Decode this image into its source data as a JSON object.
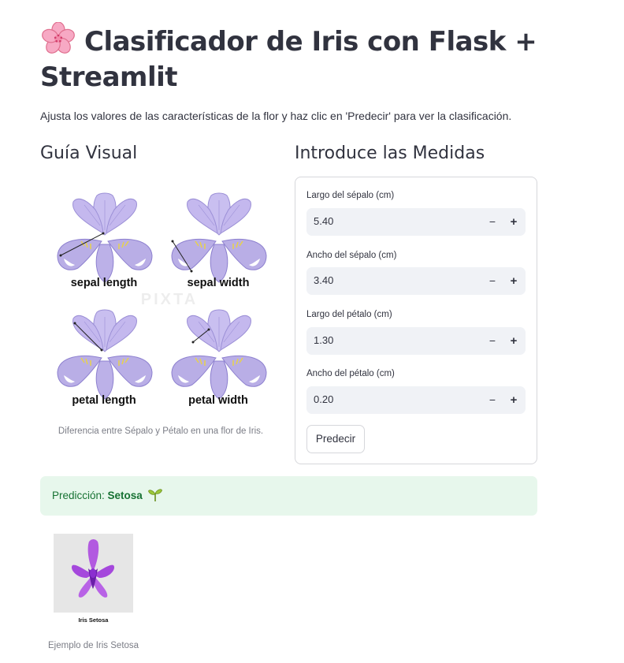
{
  "header": {
    "title": "Clasificador de Iris con Flask + Streamlit",
    "subtitle": "Ajusta los valores de las características de la flor y haz clic en 'Predecir' para ver la clasificación.",
    "title_icon": "cherry-blossom-icon"
  },
  "left_column": {
    "heading": "Guía Visual",
    "image_labels": [
      "sepal length",
      "sepal width",
      "petal length",
      "petal width"
    ],
    "watermark": "PIXTA",
    "caption": "Diferencia entre Sépalo y Pétalo en una flor de Iris."
  },
  "right_column": {
    "heading": "Introduce las Medidas",
    "fields": [
      {
        "label": "Largo del sépalo (cm)",
        "value": "5.40"
      },
      {
        "label": "Ancho del sépalo (cm)",
        "value": "3.40"
      },
      {
        "label": "Largo del pétalo (cm)",
        "value": "1.30"
      },
      {
        "label": "Ancho del pétalo (cm)",
        "value": "0.20"
      }
    ],
    "stepper": {
      "minus": "−",
      "plus": "+"
    },
    "predict_label": "Predecir"
  },
  "result": {
    "prefix": "Predicción: ",
    "value": "Setosa",
    "icon": "seedling-icon",
    "image_label": "Iris Setosa",
    "image_caption": "Ejemplo de Iris Setosa"
  },
  "colors": {
    "text": "#31333f",
    "input_bg": "#f0f2f6",
    "success_bg": "#e7f7ec",
    "success_text": "#177233",
    "petal": "#b9aee6"
  }
}
